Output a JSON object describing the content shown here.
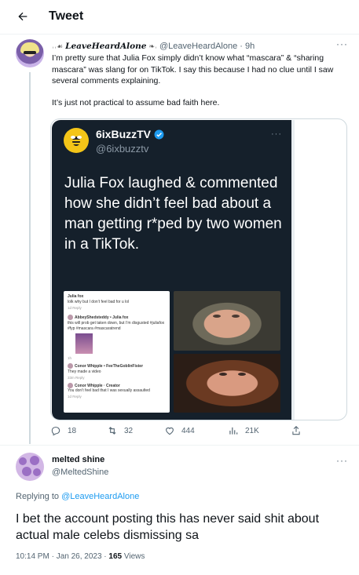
{
  "header": {
    "title": "Tweet"
  },
  "tweet1": {
    "display_name": "LeaveHeardAlone",
    "handle": "@LeaveHeardAlone",
    "time": "· 9h",
    "text_1": "I’m pretty sure that Julia Fox simply didn’t know what “mascara” & “sharing mascara” was slang for on TikTok. I say this because I had no clue until I saw several comments explaining.",
    "text_2": "It’s just not practical to assume bad faith here.",
    "stats": {
      "replies": "18",
      "retweets": "32",
      "likes": "444",
      "views": "21K"
    }
  },
  "quote": {
    "display_name": "6ixBuzzTV",
    "handle": "@6ixbuzztv",
    "text": "Julia Fox laughed & commented how she didn’t feel bad about a man getting r*ped by two women in a TikTok.",
    "shot": {
      "c1_user": "Julia fox",
      "c1_text": "lolk why but I don’t feel bad for u lol",
      "c1_meta": "1d   Reply",
      "c2_user": "AbbeyShedsteddy • Julia fox",
      "c2_text": "this will prob get taken down, but I’m disgusted #juliafox #fyp #mascara #mascaratrend",
      "c2_meta": "1h",
      "c3_user": "Conor Whipple • FeeTheGoblinFister",
      "c3_text": "They made a video",
      "c3_meta": "33m   Reply",
      "c4_user": "Conor Whipple · Creator",
      "c4_text": "You don’t feel bad that I was sexually assaulted",
      "c4_meta": "1d   Reply"
    }
  },
  "tweet2": {
    "display_name": "melted shine",
    "handle": "@MeltedShine",
    "replying_prefix": "Replying to ",
    "replying_to": "@LeaveHeardAlone",
    "text": "I bet the account posting this has never said shit about actual male celebs dismissing sa",
    "timestamp": "10:14 PM · Jan 26, 2023 · ",
    "views_count": "165",
    "views_label": " Views"
  },
  "colors": {
    "link": "#1d9bf0",
    "secondary_text": "#536471",
    "quote_bg": "#15202b",
    "logo_bg": "#f4c518"
  },
  "icons": [
    "back-arrow-icon",
    "more-icon",
    "verified-badge-icon",
    "reply-icon",
    "retweet-icon",
    "like-icon",
    "views-icon",
    "share-icon"
  ]
}
